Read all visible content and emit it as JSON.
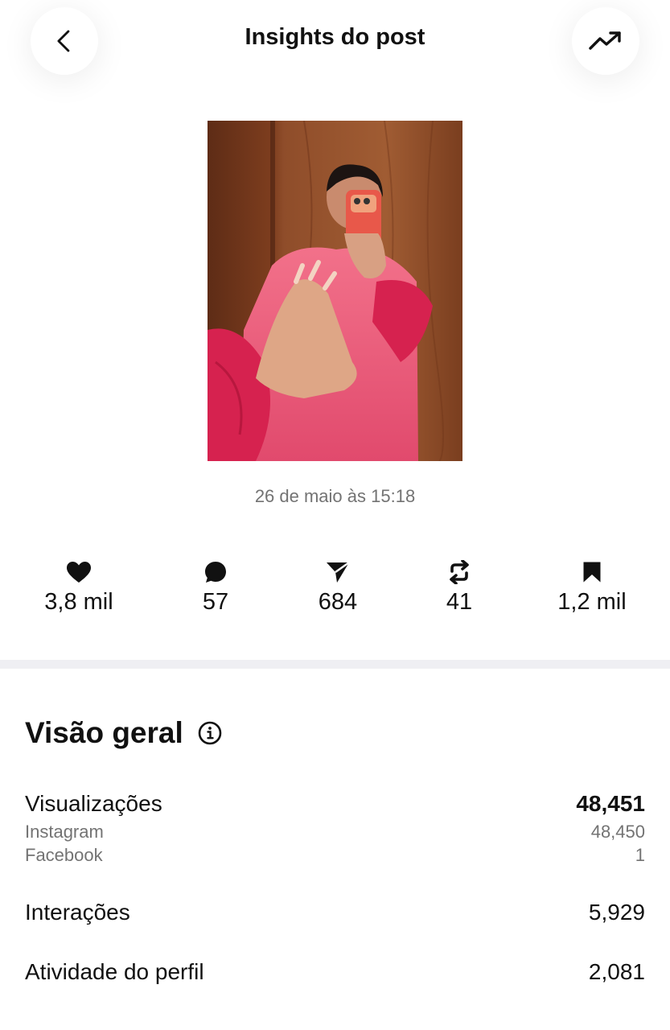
{
  "header": {
    "title": "Insights do post",
    "back_icon": "chevron-left-icon",
    "trend_icon": "trending-up-icon"
  },
  "post": {
    "date": "26 de maio às 15:18",
    "image_description_icon": "post-photo"
  },
  "stats": [
    {
      "icon": "heart-icon",
      "value": "3,8 mil"
    },
    {
      "icon": "comment-icon",
      "value": "57"
    },
    {
      "icon": "send-icon",
      "value": "684"
    },
    {
      "icon": "repost-icon",
      "value": "41"
    },
    {
      "icon": "bookmark-icon",
      "value": "1,2 mil"
    }
  ],
  "overview": {
    "title": "Visão geral",
    "views": {
      "label": "Visualizações",
      "value": "48,451",
      "instagram_label": "Instagram",
      "instagram_value": "48,450",
      "facebook_label": "Facebook",
      "facebook_value": "1"
    },
    "interactions": {
      "label": "Interações",
      "value": "5,929"
    },
    "profile_activity": {
      "label": "Atividade do perfil",
      "value": "2,081"
    }
  },
  "colors": {
    "text": "#111111",
    "muted": "#737373",
    "divider": "#efeff3"
  }
}
